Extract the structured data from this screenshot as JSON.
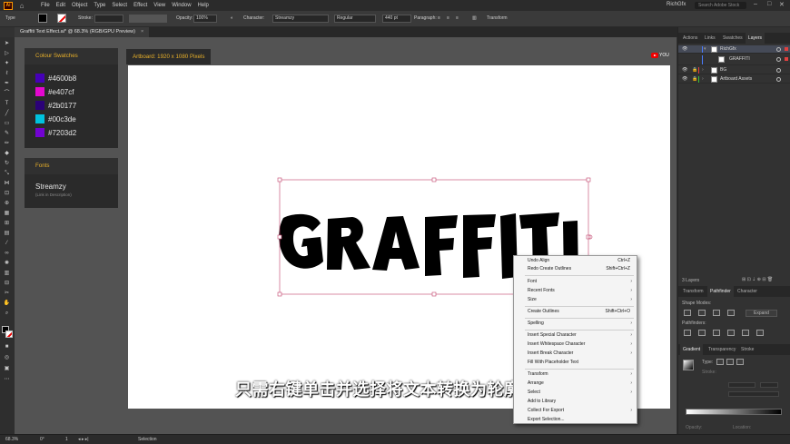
{
  "app": {
    "logo": "Ai",
    "menu": [
      "File",
      "Edit",
      "Object",
      "Type",
      "Select",
      "Effect",
      "View",
      "Window",
      "Help"
    ],
    "workspace": "RichGfx",
    "search_placeholder": "Search Adobe Stock"
  },
  "control_bar": {
    "selection_label": "Type",
    "stroke_label": "Stroke:",
    "opacity_label": "Opacity:",
    "opacity_value": "100%",
    "character_label": "Character:",
    "font_family": "Streamzy",
    "font_style": "Regular",
    "font_size": "440 pt",
    "paragraph_label": "Paragraph:",
    "transform_label": "Transform"
  },
  "document_tab": {
    "title": "Graffiti Text Effect.ai* @ 68.3% (RGB/GPU Preview)",
    "close": "×"
  },
  "canvas": {
    "artboard_label": "Artboard: 1920 x 1080 Pixels",
    "youtube_label": "YOU",
    "artwork_text": "GRAFFITI"
  },
  "colour_swatches": {
    "title": "Colour Swatches",
    "items": [
      {
        "hex": "#4600b8",
        "color": "#4600b8"
      },
      {
        "hex": "#e407cf",
        "color": "#e407cf"
      },
      {
        "hex": "#2b0177",
        "color": "#2b0177"
      },
      {
        "hex": "#00c3de",
        "color": "#00c3de"
      },
      {
        "hex": "#7203d2",
        "color": "#7203d2"
      }
    ]
  },
  "fonts_card": {
    "title": "Fonts",
    "font_name": "Streamzy",
    "note": "(Link in Description)"
  },
  "subtitle": "只需右键单击并选择将文本转换为轮廓",
  "context_menu": {
    "items": [
      {
        "label": "Undo Align",
        "shortcut": "Ctrl+Z"
      },
      {
        "label": "Redo Create Outlines",
        "shortcut": "Shift+Ctrl+Z"
      },
      {
        "label": "Font",
        "arrow": "›"
      },
      {
        "label": "Recent Fonts",
        "arrow": "›"
      },
      {
        "label": "Size",
        "arrow": "›"
      },
      {
        "label": "Create Outlines",
        "shortcut": "Shift+Ctrl+O"
      },
      {
        "label": "Spelling",
        "arrow": "›"
      },
      {
        "label": "Insert Special Character",
        "arrow": "›"
      },
      {
        "label": "Insert Whitespace Character",
        "arrow": "›"
      },
      {
        "label": "Insert Break Character",
        "arrow": "›"
      },
      {
        "label": "Fill With Placeholder Text"
      },
      {
        "label": "Transform",
        "arrow": "›"
      },
      {
        "label": "Arrange",
        "arrow": "›"
      },
      {
        "label": "Select",
        "arrow": "›"
      },
      {
        "label": "Add to Library"
      },
      {
        "label": "Collect For Export",
        "arrow": "›"
      },
      {
        "label": "Export Selection..."
      }
    ]
  },
  "layers_panel": {
    "tabs": [
      "Actions",
      "Links",
      "Swatches",
      "Layers"
    ],
    "rows": [
      {
        "name": "RichGfx",
        "bar_color": "#4a7cff",
        "selected": true,
        "sq_color": "#e04040"
      },
      {
        "name": "GRAFFITI",
        "bar_color": "#4a7cff",
        "selected": false,
        "sq_color": "#e04040"
      },
      {
        "name": "BG",
        "bar_color": "#e04040",
        "selected": false,
        "sq_color": "#e04040"
      },
      {
        "name": "Artboard Assets",
        "bar_color": "#38c038",
        "selected": false,
        "sq_color": "#38c038"
      }
    ],
    "layer_count": "3 Layers"
  },
  "pathfinder_panel": {
    "tabs": [
      "Transform",
      "Pathfinder",
      "Character"
    ],
    "shape_modes": "Shape Modes:",
    "expand": "Expand",
    "pathfinders": "Pathfinders:"
  },
  "gradient_panel": {
    "tabs": [
      "Gradient",
      "Transparency",
      "Stroke"
    ],
    "type_label": "Type:",
    "stroke_label": "Stroke:",
    "opacity_label": "Opacity:",
    "location_label": "Location:"
  },
  "status_bar": {
    "zoom": "68.3%",
    "rotation": "0°",
    "artboard_num": "1",
    "tool": "Selection"
  }
}
